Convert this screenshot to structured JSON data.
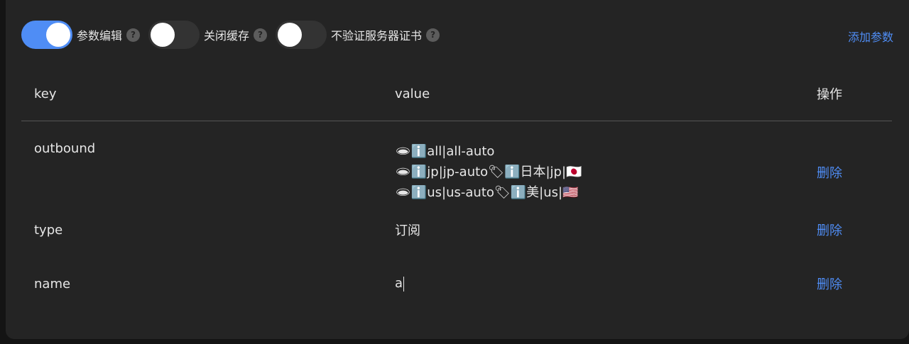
{
  "toolbar": {
    "switches": [
      {
        "label": "参数编辑",
        "on": true
      },
      {
        "label": "关闭缓存",
        "on": false
      },
      {
        "label": "不验证服务器证书",
        "on": false
      }
    ],
    "help_glyph": "?",
    "add_label": "添加参数"
  },
  "table": {
    "headers": {
      "key": "key",
      "value": "value",
      "action": "操作"
    },
    "rows": [
      {
        "key": "outbound",
        "value_lines": [
          "🕳ℹ️all|all-auto",
          "🕳ℹ️jp|jp-auto🏷ℹ️日本|jp|🇯🇵",
          "🕳ℹ️us|us-auto🏷ℹ️美|us|🇺🇸"
        ],
        "action": "删除"
      },
      {
        "key": "type",
        "value": "订阅",
        "action": "删除"
      },
      {
        "key": "name",
        "value": "a",
        "action": "删除"
      }
    ]
  },
  "colors": {
    "accent": "#4f8df5",
    "panel": "#242424",
    "background": "#141414"
  }
}
